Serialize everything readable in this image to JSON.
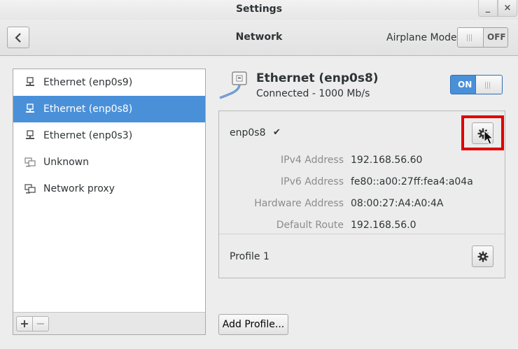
{
  "window": {
    "title": "Settings",
    "minimize_glyph": "_",
    "close_glyph": "×"
  },
  "header": {
    "title": "Network",
    "back_icon": "chevron-left-icon",
    "airplane_label": "Airplane Mode",
    "airplane_state": "OFF"
  },
  "devices": [
    {
      "label": "Ethernet (enp0s9)",
      "icon": "wired-network-icon",
      "selected": false
    },
    {
      "label": "Ethernet (enp0s8)",
      "icon": "wired-network-icon",
      "selected": true
    },
    {
      "label": "Ethernet (enp0s3)",
      "icon": "wired-network-icon",
      "selected": false
    },
    {
      "label": "Unknown",
      "icon": "network-unknown-icon",
      "selected": false
    },
    {
      "label": "Network proxy",
      "icon": "network-proxy-icon",
      "selected": false
    }
  ],
  "list_toolbar": {
    "add_label": "+",
    "remove_label": "−"
  },
  "device": {
    "name": "Ethernet (enp0s8)",
    "status": "Connected - 1000 Mb/s",
    "switch_label": "ON",
    "interface": "enp0s8",
    "check": "✔",
    "details": [
      {
        "label": "IPv4 Address",
        "value": "192.168.56.60"
      },
      {
        "label": "IPv6 Address",
        "value": "fe80::a00:27ff:fea4:a04a"
      },
      {
        "label": "Hardware Address",
        "value": "08:00:27:A4:A0:4A"
      },
      {
        "label": "Default Route",
        "value": "192.168.56.0"
      }
    ],
    "profile": "Profile 1",
    "add_profile": "Add Profile..."
  },
  "colors": {
    "selection": "#4a90d9",
    "highlight": "#e00000"
  }
}
